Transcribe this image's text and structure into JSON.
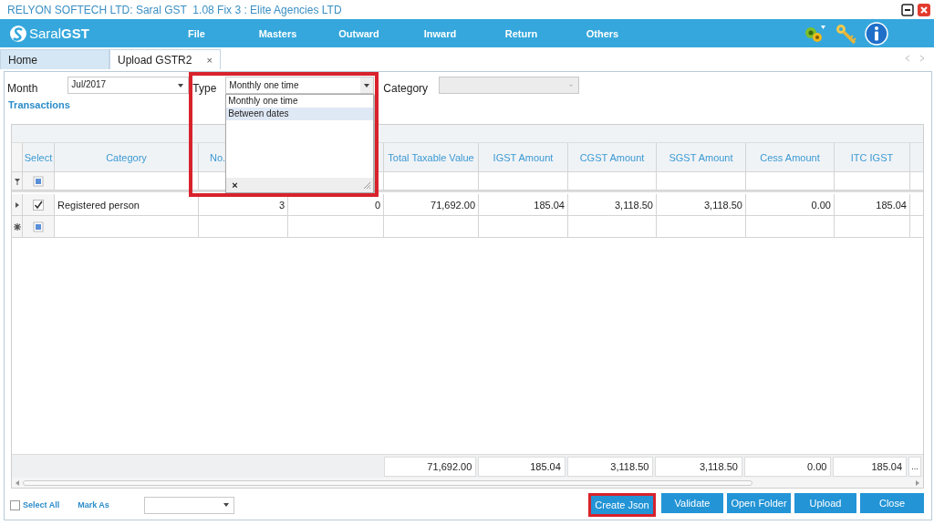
{
  "window": {
    "title": "RELYON SOFTECH LTD: Saral GST  1.08 Fix 3 : Elite Agencies LTD"
  },
  "logo": {
    "text": "Saral**GST**"
  },
  "menu": [
    {
      "label": "File"
    },
    {
      "label": "Masters"
    },
    {
      "label": "Outward"
    },
    {
      "label": "Inward"
    },
    {
      "label": "Return"
    },
    {
      "label": "Others"
    }
  ],
  "tabs": [
    {
      "label": "Home",
      "selected": false
    },
    {
      "label": "Upload GSTR2",
      "selected": true,
      "close": "×"
    }
  ],
  "filters": {
    "month_label": "Month",
    "month_value": "Jul/2017",
    "type_label": "Type",
    "type_value": "Monthly one time",
    "type_highlighted": true,
    "type_open": true,
    "type_options": [
      {
        "label": "Monthly one time",
        "selected": false
      },
      {
        "label": "Between dates",
        "selected": true
      }
    ],
    "type_popup_close": "×",
    "category_label": "Category",
    "category_disabled": true
  },
  "section_title": "Transactions",
  "table": {
    "columns": [
      "Select",
      "Category",
      "No.",
      "",
      "Total Taxable Value",
      "IGST Amount",
      "CGST Amount",
      "SGST Amount",
      "Cess Amount",
      "ITC IGST"
    ],
    "rows": [
      {
        "kind": "filter",
        "checked": false,
        "cells": [
          "",
          "",
          "",
          "",
          "",
          "",
          "",
          "",
          "",
          ""
        ]
      },
      {
        "kind": "data",
        "checked": true,
        "cells": [
          "",
          "Registered person",
          "3",
          "0",
          "71,692.00",
          "185.04",
          "3,118.50",
          "3,118.50",
          "0.00",
          "185.04"
        ]
      },
      {
        "kind": "new",
        "checked": false,
        "cells": [
          "",
          "",
          "",
          "",
          "",
          "",
          "",
          "",
          "",
          ""
        ]
      }
    ],
    "totals": [
      "71,692.00",
      "185.04",
      "3,118.50",
      "3,118.50",
      "0.00",
      "185.04"
    ],
    "totals_more": "..."
  },
  "footer": {
    "select_all_label": "Select All",
    "select_all_checked": false,
    "mark_as_label": "Mark As"
  },
  "buttons": [
    {
      "label": "Create Json",
      "highlighted": true
    },
    {
      "label": "Validate",
      "highlighted": false
    },
    {
      "label": "Open Folder",
      "highlighted": false
    },
    {
      "label": "Upload",
      "highlighted": false
    },
    {
      "label": "Close",
      "highlighted": false
    }
  ]
}
